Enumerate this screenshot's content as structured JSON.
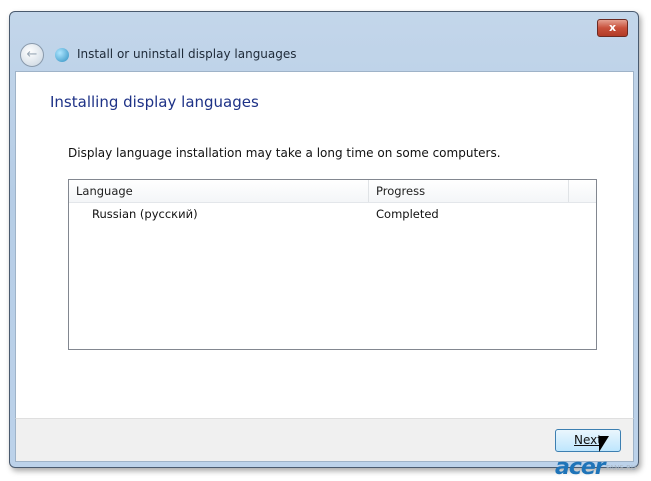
{
  "window": {
    "title": "Install or uninstall display languages",
    "close_label": "x"
  },
  "main": {
    "heading": "Installing display languages",
    "description": "Display language installation may take a long time on some computers."
  },
  "list": {
    "columns": [
      "Language",
      "Progress"
    ],
    "rows": [
      {
        "language": "Russian (русский)",
        "progress": "Completed"
      }
    ]
  },
  "footer": {
    "next_label": "Next"
  },
  "watermark": {
    "logo": "acer",
    "site": "FANS.RU"
  }
}
